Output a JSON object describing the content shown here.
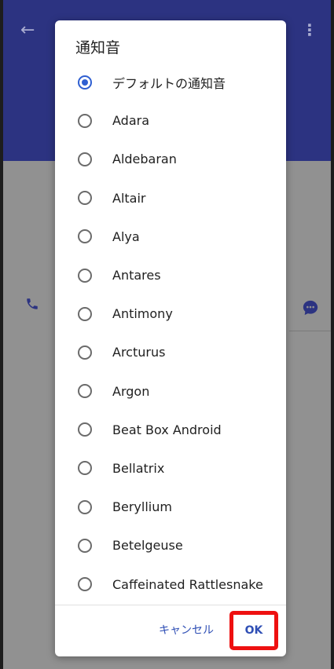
{
  "dialog": {
    "title": "通知音",
    "options": [
      {
        "label": "デフォルトの通知音",
        "checked": true
      },
      {
        "label": "Adara",
        "checked": false
      },
      {
        "label": "Aldebaran",
        "checked": false
      },
      {
        "label": "Altair",
        "checked": false
      },
      {
        "label": "Alya",
        "checked": false
      },
      {
        "label": "Antares",
        "checked": false
      },
      {
        "label": "Antimony",
        "checked": false
      },
      {
        "label": "Arcturus",
        "checked": false
      },
      {
        "label": "Argon",
        "checked": false
      },
      {
        "label": "Beat Box Android",
        "checked": false
      },
      {
        "label": "Bellatrix",
        "checked": false
      },
      {
        "label": "Beryllium",
        "checked": false
      },
      {
        "label": "Betelgeuse",
        "checked": false
      },
      {
        "label": "Caffeinated Rattlesnake",
        "checked": false
      }
    ],
    "cancel_label": "キャンセル",
    "ok_label": "OK"
  },
  "background": {
    "back_icon": "arrow-left",
    "more_icon": "vertical-dots",
    "left_icon": "phone-icon",
    "right_icon": "chat-bubble-icon"
  },
  "colors": {
    "accent": "#2f5fd1",
    "appbar": "#2c3381",
    "highlight": "#ee1010"
  }
}
